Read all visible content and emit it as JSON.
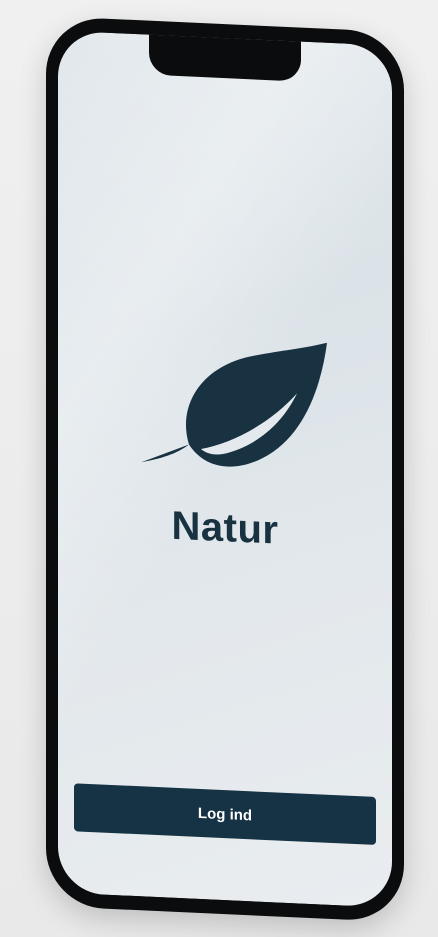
{
  "app": {
    "title": "Natur",
    "logo_icon": "leaf-icon",
    "brand_color": "#183241"
  },
  "actions": {
    "login_label": "Log ind",
    "login_color": "#153344"
  }
}
